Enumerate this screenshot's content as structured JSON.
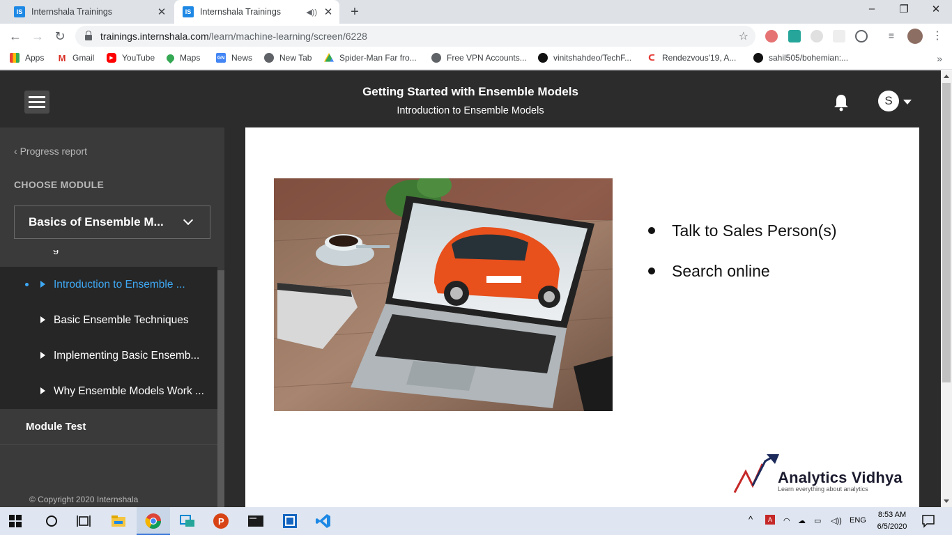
{
  "browser": {
    "tabs": [
      {
        "title": "Internshala Trainings",
        "favicon": "IS"
      },
      {
        "title": "Internshala Trainings",
        "favicon": "IS",
        "active": true
      }
    ],
    "url_host": "trainings.internshala.com",
    "url_path": "/learn/machine-learning/screen/6228",
    "bookmarks": [
      {
        "label": "Apps",
        "icon": "apps-grid-icon",
        "color": "#e8453c"
      },
      {
        "label": "Gmail",
        "icon": "gmail-icon",
        "color": "#d93025"
      },
      {
        "label": "YouTube",
        "icon": "youtube-icon",
        "color": "#ff0000"
      },
      {
        "label": "Maps",
        "icon": "maps-icon",
        "color": "#34a853"
      },
      {
        "label": "News",
        "icon": "news-icon",
        "color": "#4285f4"
      },
      {
        "label": "New Tab",
        "icon": "globe-icon",
        "color": "#5f6368"
      },
      {
        "label": "Spider-Man Far fro...",
        "icon": "drive-icon",
        "color": "#fbbc04"
      },
      {
        "label": "Free VPN Accounts...",
        "icon": "globe-icon",
        "color": "#5f6368"
      },
      {
        "label": "vinitshahdeo/TechF...",
        "icon": "github-icon",
        "color": "#111111"
      },
      {
        "label": "Rendezvous'19, A...",
        "icon": "rendezvous-icon",
        "color": "#e53935"
      },
      {
        "label": "sahil505/bohemian:...",
        "icon": "github-icon",
        "color": "#111111"
      }
    ]
  },
  "header": {
    "course_title": "Getting Started with Ensemble Models",
    "module_subtitle": "Introduction to Ensemble Models",
    "avatar_initial": "S"
  },
  "sidebar": {
    "progress_report": "Progress report",
    "choose_module": "CHOOSE MODULE",
    "selected_module": "Basics of Ensemble M...",
    "peek_item": "g",
    "lessons": [
      {
        "label": "Introduction to Ensemble ...",
        "active": true
      },
      {
        "label": "Basic Ensemble Techniques"
      },
      {
        "label": "Implementing Basic Ensemb..."
      },
      {
        "label": "Why Ensemble Models Work ..."
      }
    ],
    "module_test": "Module Test",
    "copyright": "© Copyright 2020 Internshala"
  },
  "slide": {
    "bullets": [
      "Talk to Sales Person(s)",
      "Search online"
    ],
    "logo_name": "Analytics Vidhya",
    "logo_tagline": "Learn everything about analytics"
  },
  "taskbar": {
    "language": "ENG",
    "time": "8:53 AM",
    "date": "6/5/2020"
  },
  "colors": {
    "accent": "#3fa9f5",
    "header_bg": "#2c2c2c",
    "sidebar_bg": "#3a3a3a",
    "lesson_bg": "#262626"
  }
}
